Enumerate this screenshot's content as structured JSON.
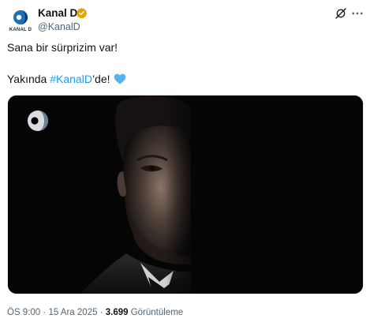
{
  "account": {
    "name": "Kanal D",
    "handle": "@KanalD",
    "avatar_text": "KANAL D",
    "verified_color": "#e3a400"
  },
  "tweet": {
    "line1": "Sana bir sürprizim var!",
    "line2_prefix": "Yakında ",
    "hashtag": "#KanalD",
    "line2_suffix": "’de!",
    "emoji": "blue-heart"
  },
  "media": {
    "type": "video-thumbnail",
    "description_icon": "kanal-d-logo"
  },
  "meta": {
    "time": "ÖS 9:00",
    "separator": "·",
    "date": "15 Ara 2025",
    "views_count": "3.699",
    "views_label": "Görüntüleme"
  },
  "colors": {
    "hashtag": "#1d9bf0",
    "secondary_text": "#536471",
    "heart": "#5ab4ec"
  }
}
